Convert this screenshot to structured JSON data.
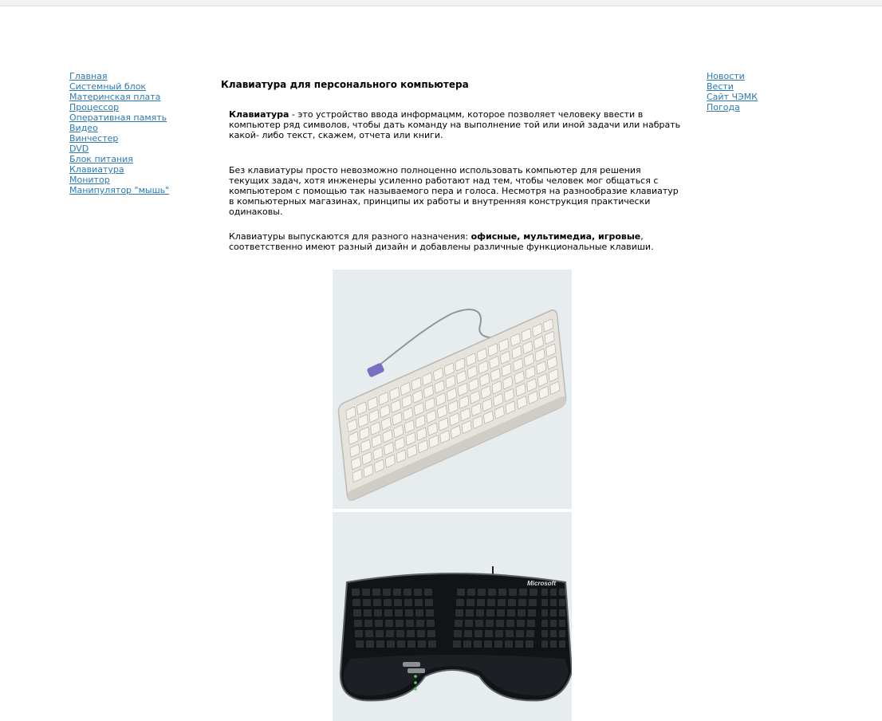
{
  "nav_left": [
    "Главная",
    "Системный блок",
    "Материнская плата",
    "Процессор",
    "Оперативная память",
    "Видео",
    "Винчестер",
    "DVD",
    "Блок питания",
    "Клавиатура",
    "Монитор",
    "Манипулятор \"мышь\""
  ],
  "nav_right": [
    "Новости",
    "Вести",
    "Сайт ЧЭМК",
    "Погода"
  ],
  "article": {
    "title": "Клавиатура для персонального компьютера",
    "p1_term": "Клавиатура",
    "p1_text": " - это устройство ввода информацмм, которое позволяет человеку ввести в компьютер ряд символов, чтобы дать команду на выполнение той или иной задачи или набрать какой- либо текст, скажем, отчета или книги.",
    "p2_text": "Без клавиатуры просто невозможно полноценно использовать компьютер для решения текущих задач, хотя инженеры усиленно работают над тем, чтобы человек мог общаться с компьютером с помощью так называемого пера и голоса. Несмотря на разнообразие клавиатур в компьютерных магазинах, принципы их работы и внутренняя конструкция практически одинаковы.",
    "p3_pre": "Клавиатуры выпускаются для разного назначения: ",
    "p3_bold": "офисные, мультимедиа, игровые",
    "p3_post": ", соответственно имеют разный дизайн и добавлены различные функциональные клавиши."
  },
  "images": {
    "keyboard2_brand": "Microsoft"
  },
  "colors": {
    "link": "#2a79b6",
    "image_bg": "#e7ecef"
  }
}
